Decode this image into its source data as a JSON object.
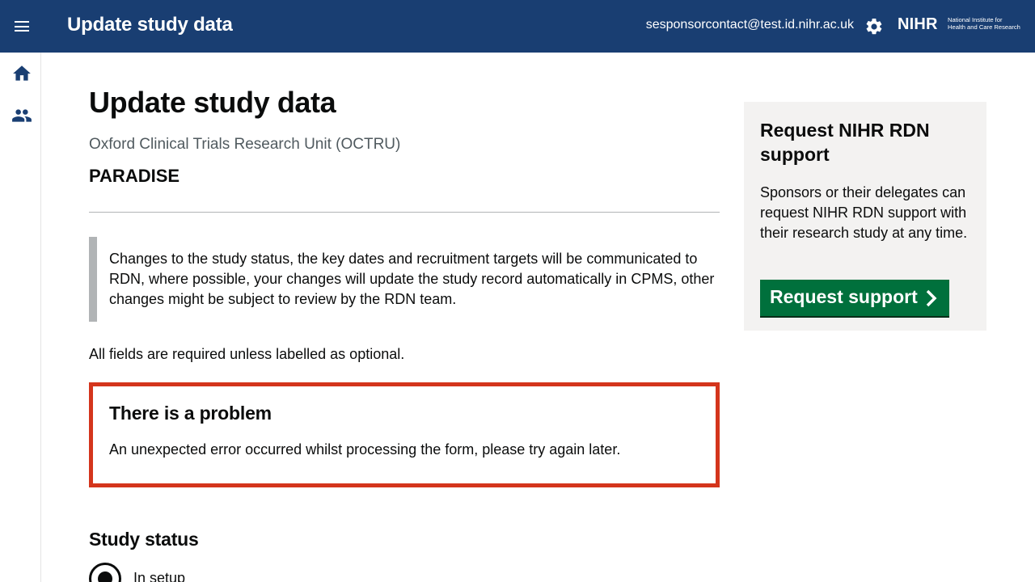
{
  "header": {
    "title": "Update study data",
    "user_email": "sesponsorcontact@test.id.nihr.ac.uk",
    "logo_text": "NIHR",
    "logo_subtitle_line1": "National Institute for",
    "logo_subtitle_line2": "Health and Care Research",
    "icons": [
      "menu-icon",
      "gear-icon"
    ]
  },
  "sidenav": {
    "items": [
      {
        "icon": "home-icon"
      },
      {
        "icon": "people-icon"
      }
    ]
  },
  "main": {
    "page_title": "Update study data",
    "organisation": "Oxford Clinical Trials Research Unit (OCTRU)",
    "study_short_name": "PARADISE",
    "inset_text": "Changes to the study status, the key dates and recruitment targets will be communicated to RDN, where possible, your changes will update the study record automatically in CPMS, other changes might be subject to review by the RDN team.",
    "required_note": "All fields are required unless labelled as optional.",
    "error_summary": {
      "title": "There is a problem",
      "message": "An unexpected error occurred whilst processing the form, please try again later."
    },
    "study_status": {
      "heading": "Study status",
      "options": [
        {
          "label": "In setup",
          "selected": true
        }
      ]
    }
  },
  "sidebar_card": {
    "title": "Request NIHR RDN support",
    "text": "Sponsors or their delegates can request NIHR RDN support with their research study at any time.",
    "button_label": "Request support"
  },
  "colors": {
    "header_bg": "#193e72",
    "error_border": "#d4351c",
    "button_green": "#00703c",
    "inset_border": "#b1b4b6",
    "card_bg": "#f3f2f1"
  }
}
